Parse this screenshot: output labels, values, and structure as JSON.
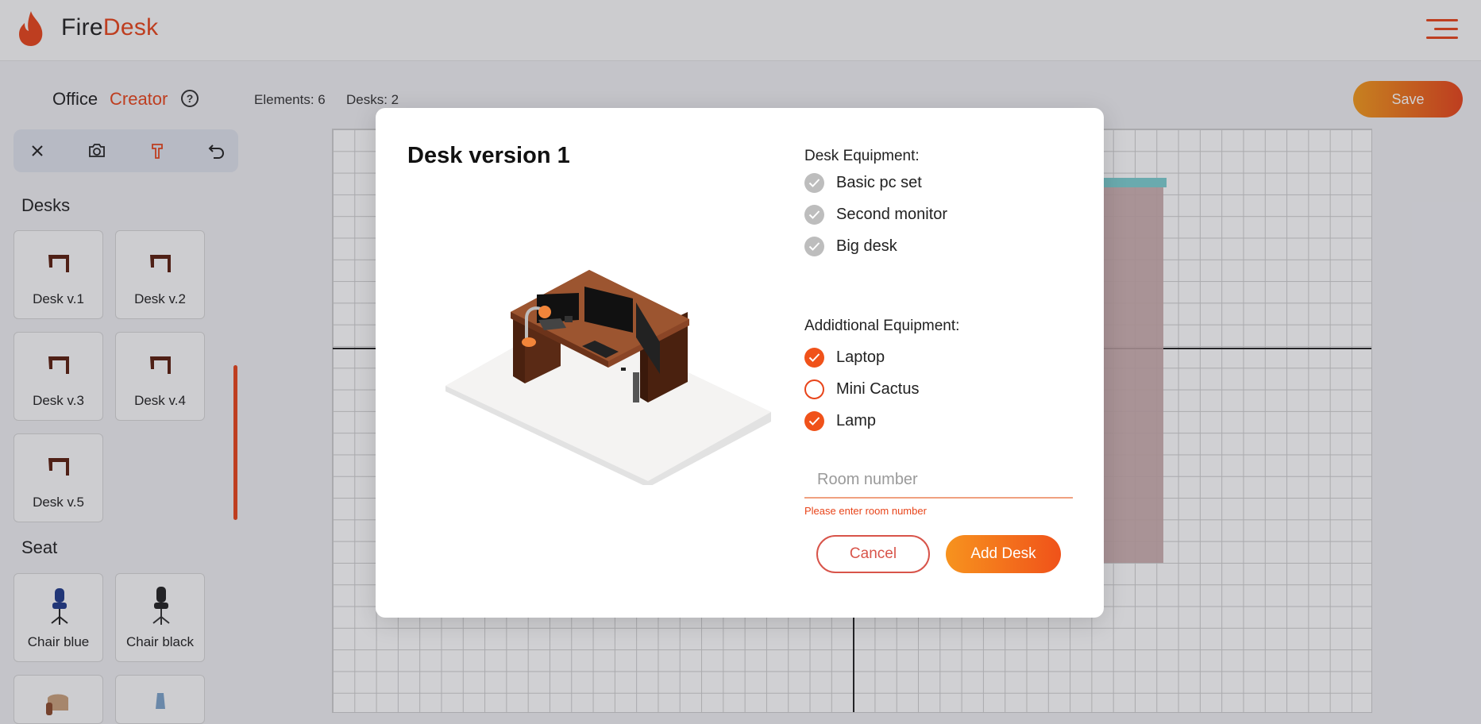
{
  "colors": {
    "accent": "#e8441a",
    "accent_gradient_start": "#f39a1a"
  },
  "header": {
    "brand_part1": "Fire",
    "brand_part2": "Desk",
    "logo_icon": "flame-icon",
    "menu_icon": "hamburger-menu-icon"
  },
  "subheader": {
    "title_part1": "Office",
    "title_part2": "Creator",
    "help_label": "?",
    "elements_label": "Elements: 6",
    "desks_label": "Desks: 2",
    "save_label": "Save"
  },
  "toolbar": {
    "tools": [
      "close-icon",
      "camera-icon",
      "hammer-icon",
      "undo-icon"
    ]
  },
  "sidebar": {
    "desks_title": "Desks",
    "desks": [
      {
        "label": "Desk v.1",
        "icon": "desk-icon"
      },
      {
        "label": "Desk v.2",
        "icon": "desk-icon"
      },
      {
        "label": "Desk v.3",
        "icon": "desk-icon"
      },
      {
        "label": "Desk v.4",
        "icon": "desk-icon"
      },
      {
        "label": "Desk v.5",
        "icon": "desk-icon"
      }
    ],
    "seat_title": "Seat",
    "seats": [
      {
        "label": "Chair blue",
        "icon": "office-chair-icon",
        "color": "#1f3a8a"
      },
      {
        "label": "Chair black",
        "icon": "office-chair-icon",
        "color": "#222222"
      }
    ]
  },
  "modal": {
    "title": "Desk version 1",
    "desk_equipment_title": "Desk Equipment:",
    "desk_equipment": [
      {
        "label": "Basic pc set",
        "state": "checked-disabled"
      },
      {
        "label": "Second monitor",
        "state": "checked-disabled"
      },
      {
        "label": "Big desk",
        "state": "checked-disabled"
      }
    ],
    "additional_title": "Addidtional Equipment:",
    "additional_equipment": [
      {
        "label": "Laptop",
        "checked": true
      },
      {
        "label": "Mini Cactus",
        "checked": false
      },
      {
        "label": "Lamp",
        "checked": true
      }
    ],
    "room_placeholder": "Room number",
    "room_value": "",
    "room_error": "Please enter room number",
    "cancel_label": "Cancel",
    "add_label": "Add Desk"
  }
}
